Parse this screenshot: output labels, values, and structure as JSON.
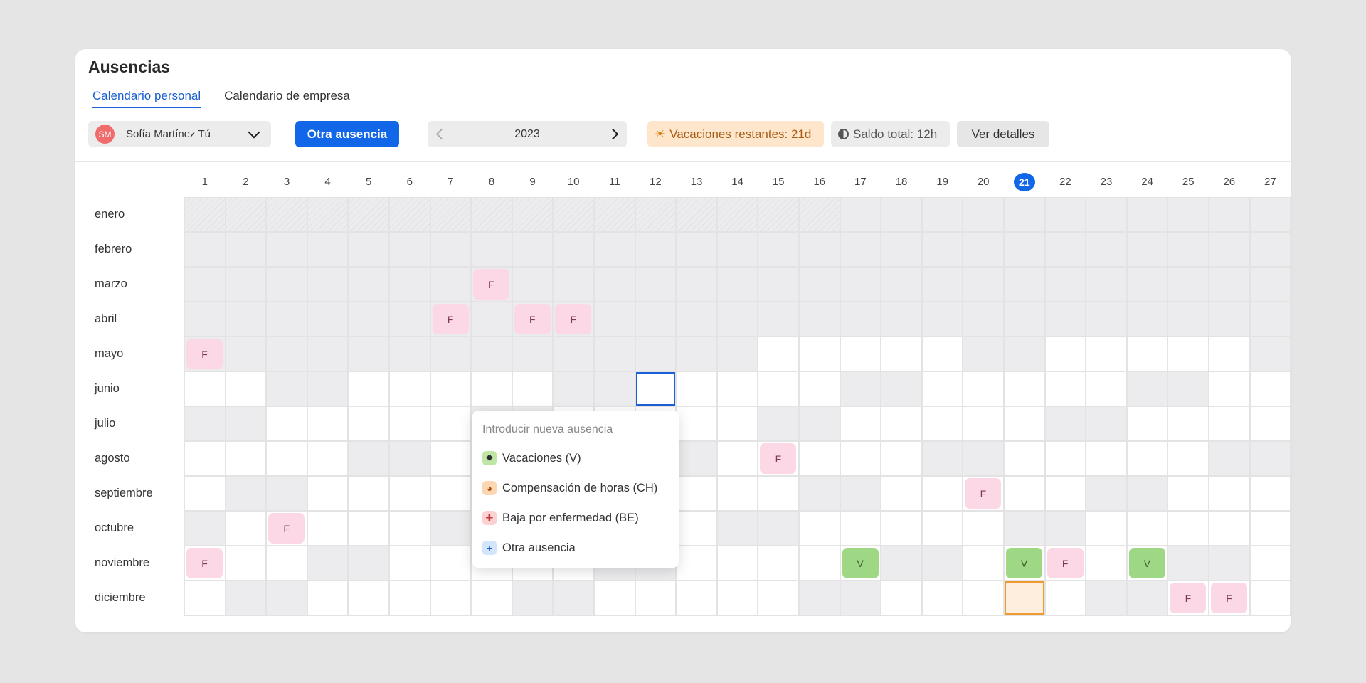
{
  "title": "Ausencias",
  "tabs": [
    {
      "label": "Calendario personal",
      "active": true
    },
    {
      "label": "Calendario de empresa",
      "active": false
    }
  ],
  "toolbar": {
    "user": {
      "initials": "SM",
      "name": "Sofía Martínez Tú"
    },
    "primary_button": "Otra ausencia",
    "year": "2023",
    "vacaciones_badge": "Vacaciones restantes: 21d",
    "saldo_badge": "Saldo total: 12h",
    "details_button": "Ver detalles"
  },
  "calendar": {
    "days": [
      "1",
      "2",
      "3",
      "4",
      "5",
      "6",
      "7",
      "8",
      "9",
      "10",
      "11",
      "12",
      "13",
      "14",
      "15",
      "16",
      "17",
      "18",
      "19",
      "20",
      "21",
      "22",
      "23",
      "24",
      "25",
      "26",
      "27"
    ],
    "today_day": 21,
    "months": [
      "enero",
      "febrero",
      "marzo",
      "abril",
      "mayo",
      "junio",
      "julio",
      "agosto",
      "septiembre",
      "octubre",
      "noviembre",
      "diciembre"
    ],
    "absences": [
      {
        "month": 2,
        "day": 8,
        "code": "F"
      },
      {
        "month": 3,
        "day": 7,
        "code": "F"
      },
      {
        "month": 3,
        "day": 9,
        "code": "F"
      },
      {
        "month": 3,
        "day": 10,
        "code": "F"
      },
      {
        "month": 4,
        "day": 1,
        "code": "F"
      },
      {
        "month": 7,
        "day": 15,
        "code": "F"
      },
      {
        "month": 8,
        "day": 20,
        "code": "F"
      },
      {
        "month": 9,
        "day": 3,
        "code": "F"
      },
      {
        "month": 10,
        "day": 1,
        "code": "F"
      },
      {
        "month": 10,
        "day": 17,
        "code": "V"
      },
      {
        "month": 10,
        "day": 21,
        "code": "V"
      },
      {
        "month": 10,
        "day": 22,
        "code": "F"
      },
      {
        "month": 10,
        "day": 24,
        "code": "V"
      },
      {
        "month": 11,
        "day": 25,
        "code": "F"
      },
      {
        "month": 11,
        "day": 26,
        "code": "F"
      }
    ],
    "selected_cell": {
      "month": 5,
      "day": 12
    },
    "highlight_cell": {
      "month": 11,
      "day": 21
    }
  },
  "popup": {
    "title": "Introducir nueva ausencia",
    "items": [
      {
        "label": "Vacaciones (V)",
        "icon": "sun-icon",
        "color": "green"
      },
      {
        "label": "Compensación de horas (CH)",
        "icon": "clock-icon",
        "color": "orange"
      },
      {
        "label": "Baja por enfermedad (BE)",
        "icon": "medical-kit-icon",
        "color": "red"
      },
      {
        "label": "Otra ausencia",
        "icon": "plus-icon",
        "color": "blue"
      }
    ]
  },
  "colors": {
    "primary": "#1167e8",
    "absence_F": "#fcd8e6",
    "absence_V": "#9fd884",
    "vacation_badge": "#fde6cc",
    "today_outline": "#ef9a2e"
  }
}
